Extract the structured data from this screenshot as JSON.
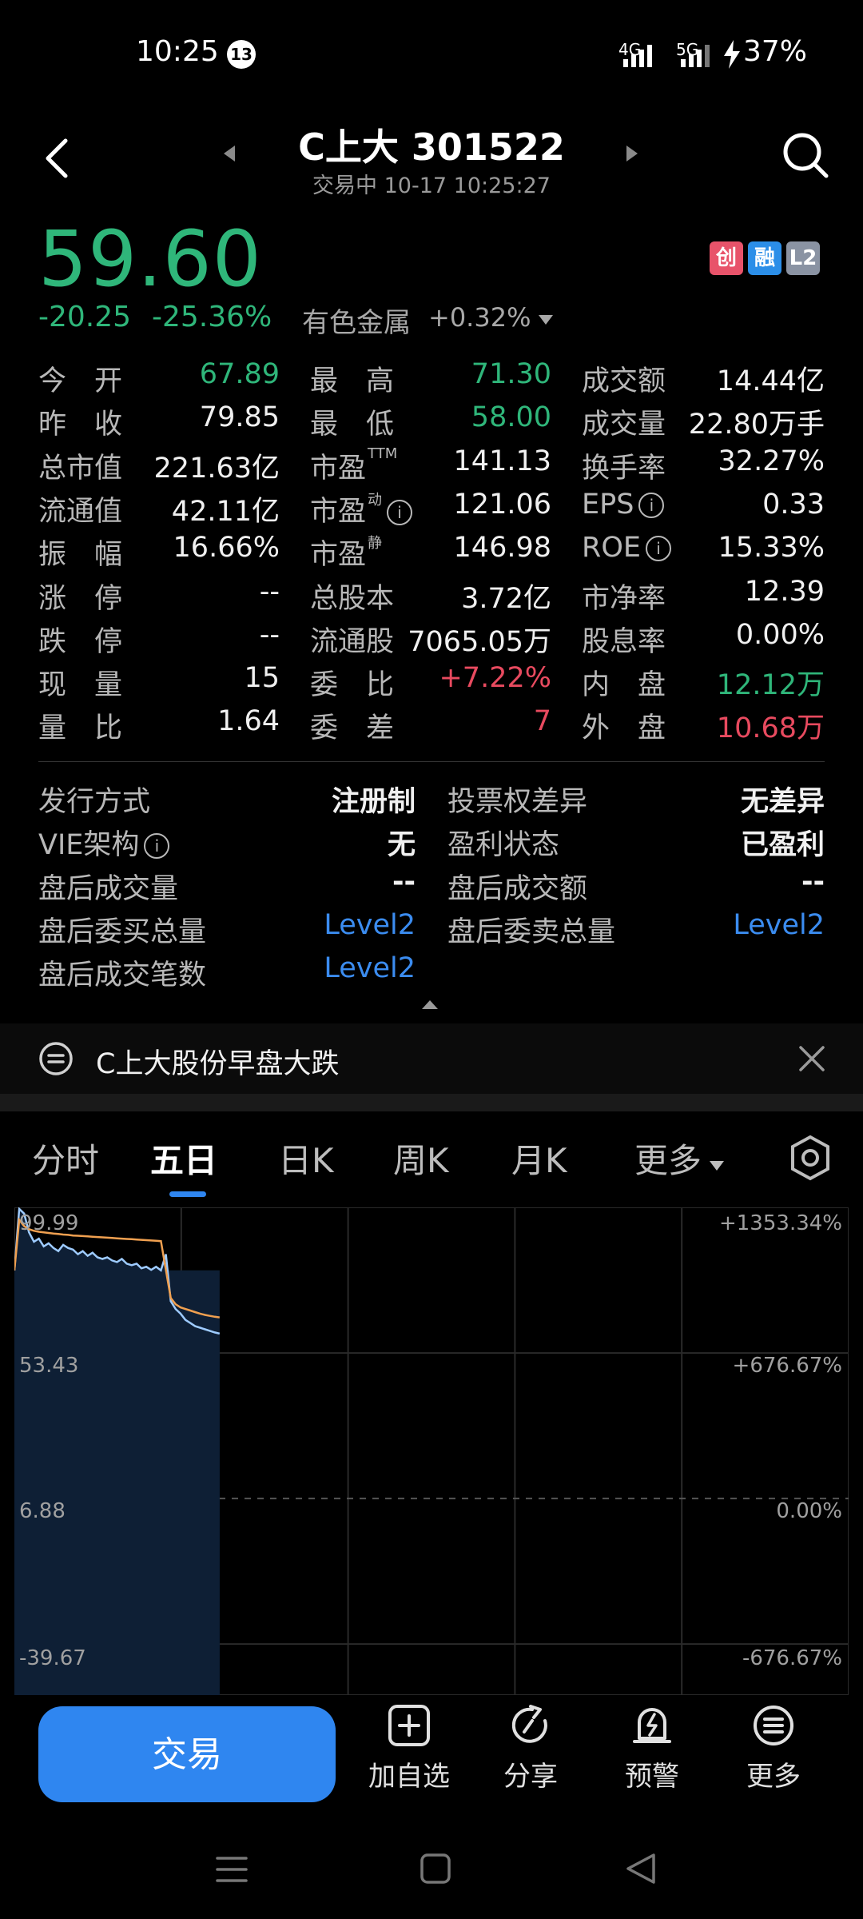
{
  "status": {
    "time": "10:25",
    "notif_count": "13",
    "net1": "4G",
    "net2": "5G",
    "battery": "37%"
  },
  "header": {
    "title": "C上大 301522",
    "subtitle": "交易中 10-17 10:25:27"
  },
  "quote": {
    "price": "59.60",
    "change": "-20.25",
    "change_pct": "-25.36%",
    "sector": "有色金属",
    "sector_chg": "+0.32%",
    "badges": [
      {
        "text": "创",
        "color": "#e8536a"
      },
      {
        "text": "融",
        "color": "#2b8ee8"
      },
      {
        "text": "L2",
        "color": "#8a93a3"
      }
    ]
  },
  "grid": [
    [
      {
        "l": "今　开",
        "v": "67.89",
        "c": "green"
      },
      {
        "l": "最　高",
        "v": "71.30",
        "c": "green"
      },
      {
        "l": "成交额",
        "v": "14.44亿",
        "c": ""
      }
    ],
    [
      {
        "l": "昨　收",
        "v": "79.85",
        "c": ""
      },
      {
        "l": "最　低",
        "v": "58.00",
        "c": "green"
      },
      {
        "l": "成交量",
        "v": "22.80万手",
        "c": ""
      }
    ],
    [
      {
        "l": "总市值",
        "v": "221.63亿",
        "c": ""
      },
      {
        "l": "市盈",
        "s": "TTM",
        "v": "141.13",
        "c": ""
      },
      {
        "l": "换手率",
        "v": "32.27%",
        "c": ""
      }
    ],
    [
      {
        "l": "流通值",
        "v": "42.11亿",
        "c": ""
      },
      {
        "l": "市盈",
        "s": "动",
        "i": true,
        "v": "121.06",
        "c": ""
      },
      {
        "l": "EPS",
        "i": true,
        "v": "0.33",
        "c": ""
      }
    ],
    [
      {
        "l": "振　幅",
        "v": "16.66%",
        "c": ""
      },
      {
        "l": "市盈",
        "s": "静",
        "v": "146.98",
        "c": ""
      },
      {
        "l": "ROE",
        "i": true,
        "v": "15.33%",
        "c": ""
      }
    ],
    [
      {
        "l": "涨　停",
        "v": "--",
        "c": ""
      },
      {
        "l": "总股本",
        "v": "3.72亿",
        "c": ""
      },
      {
        "l": "市净率",
        "v": "12.39",
        "c": ""
      }
    ],
    [
      {
        "l": "跌　停",
        "v": "--",
        "c": ""
      },
      {
        "l": "流通股",
        "v": "7065.05万",
        "c": ""
      },
      {
        "l": "股息率",
        "v": "0.00%",
        "c": ""
      }
    ],
    [
      {
        "l": "现　量",
        "v": "15",
        "c": ""
      },
      {
        "l": "委　比",
        "v": "+7.22%",
        "c": "red"
      },
      {
        "l": "内　盘",
        "v": "12.12万",
        "c": "green"
      }
    ],
    [
      {
        "l": "量　比",
        "v": "1.64",
        "c": ""
      },
      {
        "l": "委　差",
        "v": "7",
        "c": "red"
      },
      {
        "l": "外　盘",
        "v": "10.68万",
        "c": "red"
      }
    ]
  ],
  "extra": [
    [
      {
        "l": "发行方式",
        "v": "注册制",
        "c": ""
      },
      {
        "l": "投票权差异",
        "v": "无差异",
        "c": ""
      }
    ],
    [
      {
        "l": "VIE架构",
        "i": true,
        "v": "无",
        "c": ""
      },
      {
        "l": "盈利状态",
        "v": "已盈利",
        "c": ""
      }
    ],
    [
      {
        "l": "盘后成交量",
        "v": "--",
        "c": ""
      },
      {
        "l": "盘后成交额",
        "v": "--",
        "c": ""
      }
    ],
    [
      {
        "l": "盘后委买总量",
        "v": "Level2",
        "c": "blue"
      },
      {
        "l": "盘后委卖总量",
        "v": "Level2",
        "c": "blue"
      }
    ],
    [
      {
        "l": "盘后成交笔数",
        "v": "Level2",
        "c": "blue"
      }
    ]
  ],
  "news": {
    "text": "C上大股份早盘大跌"
  },
  "tabs": [
    "分时",
    "五日",
    "日K",
    "周K",
    "月K",
    "更多"
  ],
  "chart_data": {
    "type": "line",
    "days": 5,
    "y_left_labels": [
      "99.99",
      "53.43",
      "6.88",
      "-39.67"
    ],
    "y_right_labels": [
      "+1353.34%",
      "+676.67%",
      "0.00%",
      "-676.67%"
    ],
    "ylim": [
      -56.0,
      99.99
    ],
    "price_series": [
      79.85,
      99.5,
      98.0,
      92.0,
      89.0,
      90.0,
      87.5,
      88.5,
      87.0,
      86.0,
      88.0,
      87.0,
      86.5,
      85.0,
      86.0,
      84.5,
      85.5,
      84.0,
      83.5,
      84.0,
      83.0,
      82.5,
      83.5,
      82.0,
      81.5,
      82.0,
      80.5,
      81.0,
      80.0,
      81.0,
      79.85,
      85.0,
      70.0,
      67.5,
      66.0,
      64.0,
      63.0,
      62.0,
      61.5,
      61.0,
      60.5,
      60.0,
      59.6
    ],
    "avg_series": [
      79.85,
      96.0,
      94.0,
      93.0,
      92.5,
      92.2,
      92.0,
      91.8,
      91.6,
      91.5,
      91.3,
      91.2,
      91.0,
      90.9,
      90.8,
      90.7,
      90.6,
      90.5,
      90.4,
      90.3,
      90.2,
      90.1,
      90.0,
      89.9,
      89.8,
      89.7,
      89.6,
      89.5,
      89.4,
      89.3,
      89.2,
      80.0,
      71.0,
      69.0,
      68.0,
      67.5,
      67.0,
      66.5,
      66.0,
      65.6,
      65.3,
      65.0,
      64.8
    ],
    "price_color": "#9ecbff",
    "avg_color": "#f0a050"
  },
  "actions": [
    {
      "label": "加自选"
    },
    {
      "label": "分享"
    },
    {
      "label": "预警"
    },
    {
      "label": "更多"
    }
  ],
  "trade_label": "交易"
}
